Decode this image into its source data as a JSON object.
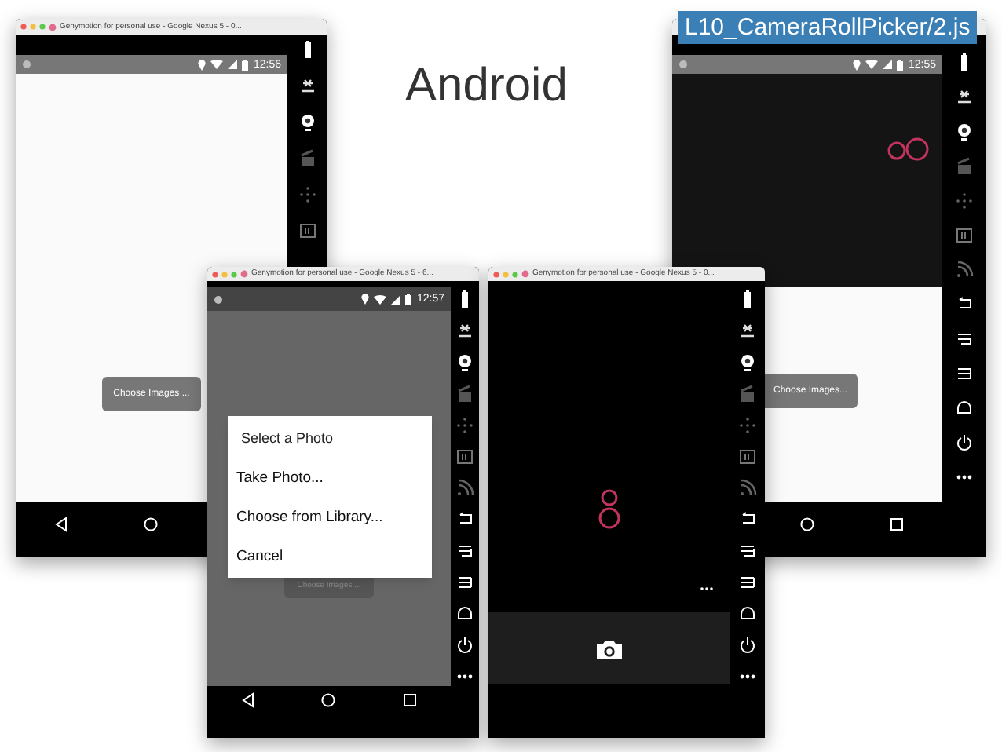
{
  "slide_title": "Android",
  "file_label": "L10_CameraRollPicker/2.js",
  "windows": [
    {
      "kind": "blank",
      "title": "Genymotion for personal use - Google Nexus 5 - 0...",
      "time": "12:56",
      "button": "Choose Images ..."
    },
    {
      "kind": "camera_roll",
      "time": "12:55",
      "button": "Choose Images..."
    },
    {
      "kind": "dialog",
      "title": "Genymotion for personal use - Google Nexus 5 - 6...",
      "time": "12:57",
      "button": "Choose Images ...",
      "dialog": {
        "title": "Select a Photo",
        "options": [
          "Take Photo...",
          "Choose from Library...",
          "Cancel"
        ]
      }
    },
    {
      "kind": "camera",
      "title": "Genymotion for personal use - Google Nexus 5 - 0..."
    }
  ]
}
